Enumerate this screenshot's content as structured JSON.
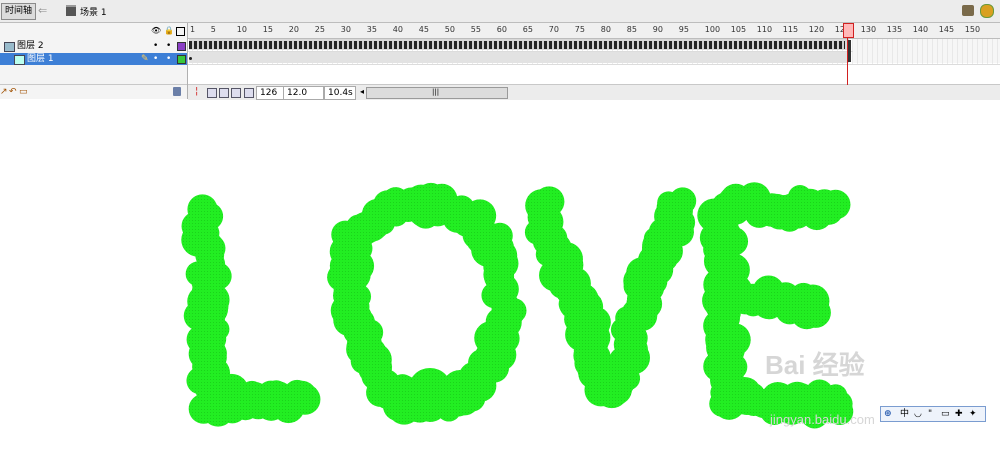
{
  "toolbar": {
    "timeline_button": "时间轴",
    "back_icon": "back-arrow-icon",
    "scene_label": "场景 1"
  },
  "timeline": {
    "header_icons": [
      "eye-icon",
      "lock-icon",
      "outline-icon"
    ],
    "layers": [
      {
        "name": "图层 2",
        "selected": false,
        "color": "#8b3fc6"
      },
      {
        "name": "图层 1",
        "selected": true,
        "color": "#39c83a"
      }
    ],
    "ruler_ticks": [
      "1",
      "5",
      "10",
      "15",
      "20",
      "25",
      "30",
      "35",
      "40",
      "45",
      "50",
      "55",
      "60",
      "65",
      "70",
      "75",
      "80",
      "85",
      "90",
      "95",
      "100",
      "105",
      "110",
      "115",
      "120",
      "125",
      "130",
      "135",
      "140",
      "145",
      "150"
    ],
    "current_frame": "126",
    "frame_rate": "12.0 fps",
    "elapsed_time": "10.4s"
  },
  "stage": {
    "artwork_text": "LOVE",
    "artwork_color": "#22ee22",
    "watermark": "Bai 经验",
    "watermark_url": "jingyan.baidu.com"
  },
  "ime": {
    "mode_label": "中"
  }
}
